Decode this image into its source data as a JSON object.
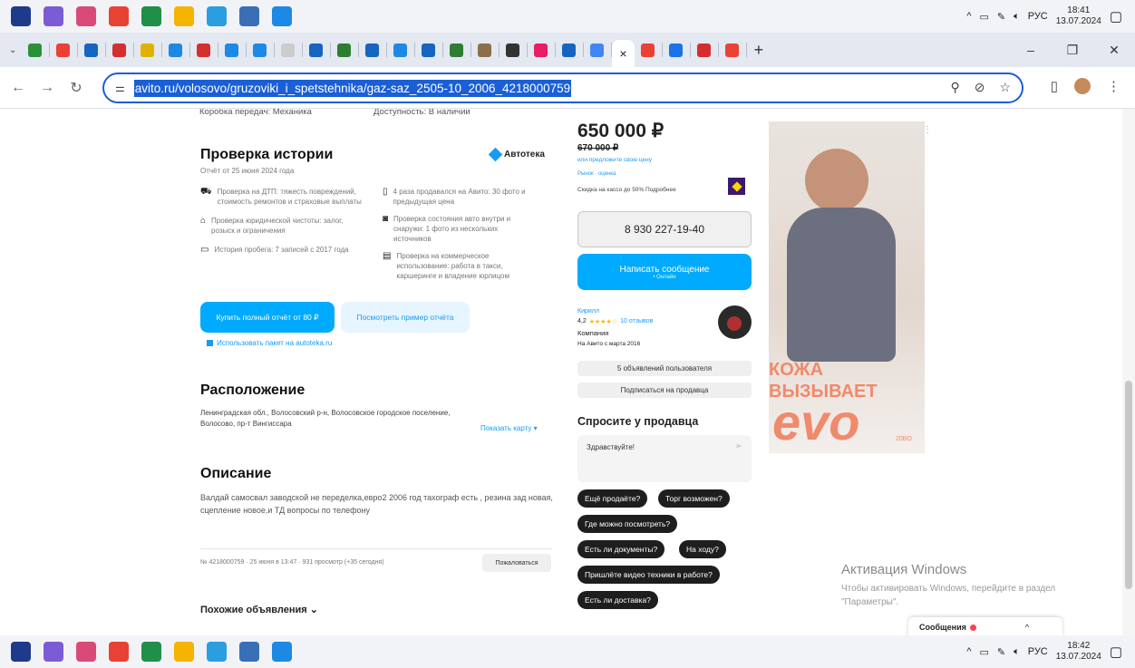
{
  "taskbar_top": {
    "apps": [
      {
        "icon": "windows-start-icon",
        "color": "#1e3a8a"
      },
      {
        "icon": "viber-icon",
        "color": "#7b5cd6"
      },
      {
        "icon": "flower-app-icon",
        "color": "#d94a78"
      },
      {
        "icon": "chrome-icon",
        "color": "#e94235"
      },
      {
        "icon": "excel-app-icon",
        "color": "#1f8f4a"
      },
      {
        "icon": "file-explorer-icon",
        "color": "#f4b400"
      },
      {
        "icon": "telegram-icon",
        "color": "#2a9ee0"
      },
      {
        "icon": "notes-app-icon",
        "color": "#3a6fb7"
      },
      {
        "icon": "photos-app-icon",
        "color": "#1e88e5"
      }
    ],
    "lang": "РУС",
    "time": "18:41",
    "date": "13.07.2024"
  },
  "taskbar_bottom": {
    "lang": "РУС",
    "time": "18:42",
    "date": "13.07.2024"
  },
  "tabs": {
    "favicons": [
      "#2c8f3a",
      "#e94235",
      "#1565c0",
      "#d32f2f",
      "#e0b200",
      "#1e88e5",
      "#d32f2f",
      "#1e88e5",
      "#1e88e5",
      "#cccccc",
      "#1565c0",
      "#2e7d32",
      "#1565c0",
      "#1e88e5",
      "#1565c0",
      "#2e7d32",
      "#8a6f4a",
      "#333333",
      "#e91e63",
      "#1565c0",
      "#4285f4"
    ],
    "active_close": "×",
    "after_active": [
      "#e94235",
      "#1a73e8",
      "#d32f2f",
      "#e94235"
    ],
    "new_tab": "+"
  },
  "address": {
    "url": "avito.ru/volosovo/gruzoviki_i_spetstehnika/gaz-saz_2505-10_2006_4218000759"
  },
  "specs": {
    "gearbox": "Коробка передач: Механика",
    "availability": "Доступность: В наличии"
  },
  "history": {
    "title": "Проверка истории",
    "report_date": "Отчёт от 25 июня 2024 года",
    "brand": "Автотека",
    "items_left": [
      "Проверка на ДТП: тяжесть повреждений, стоимость ремонтов и страховые выплаты",
      "Проверка юридической чистоты: залог, розыск и ограничения",
      "История пробега: 7 записей с 2017 года"
    ],
    "items_right": [
      "4 раза продавался на Авито: 30 фото и предыдущая цена",
      "Проверка состояния авто внутри и снаружи: 1 фото из нескольких источников",
      "Проверка на коммерческое использование: работа в такси, каршеринге и владение юрлицом"
    ],
    "buy_button": "Купить полный отчёт от 80 ₽",
    "sample_button": "Посмотреть пример отчёта",
    "package_link": "Использовать пакет на autoteka.ru"
  },
  "location": {
    "title": "Расположение",
    "address": "Ленинградская обл., Волосовский р-н, Волосовское городское поселение, Волосово, пр-т Вингиссара",
    "show_map": "Показать карту ▾"
  },
  "description": {
    "title": "Описание",
    "text": "Валдай самосвал заводской не переделка,евро2 2006 год тахограф есть , резина зад новая, сцепление новое,и ТД вопросы по телефону"
  },
  "meta": {
    "info": "№ 4218000759 · 25 июня в 13:47 · 931 просмотр (+35 сегодня)",
    "complain": "Пожаловаться"
  },
  "similar": "Похожие объявления ⌄",
  "price": {
    "current": "650 000 ₽",
    "old": "670 000 ₽",
    "offer": "или предложите свою цену",
    "tag": "Рынок · оценка",
    "discount": "Скидка на кассо до 50% Подробнее",
    "phone": "8 930 227-19-40",
    "write": "Написать сообщение",
    "online": "• Онлайн"
  },
  "seller": {
    "name": "Кирилл",
    "rating": "4,2",
    "stars": "★★★★☆",
    "reviews": "10 отзывов",
    "type": "Компания",
    "since": "На Авито с марта 2016",
    "btn_ads": "5 объявлений пользователя",
    "btn_sub": "Подписаться на продавца"
  },
  "ask": {
    "title": "Спросите у продавца",
    "message": "Здравствуйте!",
    "chips": [
      "Ещё продаёте?",
      "Торг возможен?",
      "Где можно посмотреть?",
      "Есть ли документы?",
      "На ходу?",
      "Пришлёте видео техники в работе?",
      "Есть ли доставка?"
    ]
  },
  "ad": {
    "line1": "КОЖА",
    "line2": "ВЫЗЫВАЕТ",
    "line3": "evo",
    "tiny": "20BO"
  },
  "watermark": {
    "title": "Активация Windows",
    "sub": "Чтобы активировать Windows, перейдите в раздел \"Параметры\"."
  },
  "messages": {
    "label": "Сообщения"
  },
  "colors": {
    "accent": "#00aaff",
    "link": "#1a9bf0",
    "chip": "#1e1e1e",
    "ad_orange": "#f08a6c",
    "selection": "#1a5fd6"
  }
}
